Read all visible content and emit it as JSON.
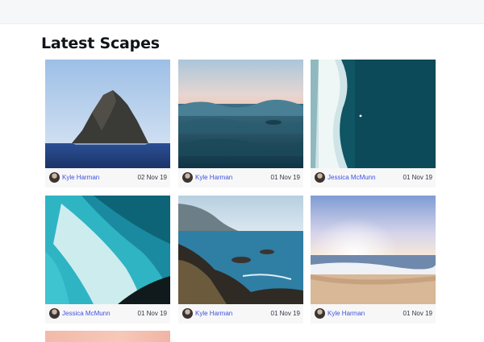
{
  "section": {
    "title": "Latest Scapes"
  },
  "cards": [
    {
      "subject": "rock island in the sea",
      "author": "Kyle Harman",
      "date": "02 Nov 19"
    },
    {
      "subject": "ocean waves at dusk",
      "author": "Kyle Harman",
      "date": "01 Nov 19"
    },
    {
      "subject": "aerial view of a wave breaking",
      "author": "Jessica McMunn",
      "date": "01 Nov 19"
    },
    {
      "subject": "aerial view of turquoise surf",
      "author": "Jessica McMunn",
      "date": "01 Nov 19"
    },
    {
      "subject": "rocky coastline",
      "author": "Kyle Harman",
      "date": "01 Nov 19"
    },
    {
      "subject": "beach at sunset",
      "author": "Kyle Harman",
      "date": "01 Nov 19"
    },
    {
      "subject": "pink sky"
    }
  ]
}
